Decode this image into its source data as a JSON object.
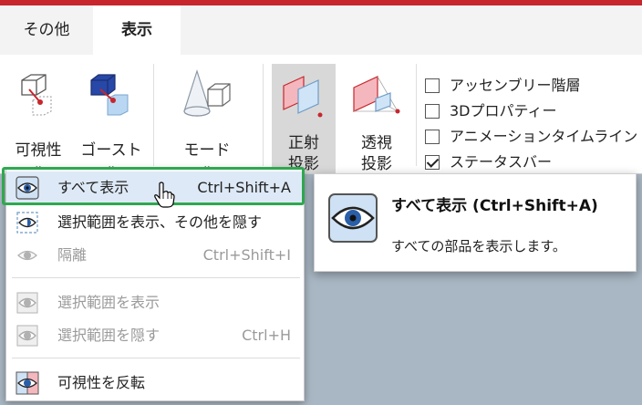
{
  "tabs": [
    {
      "label": "その他"
    },
    {
      "label": "表示"
    }
  ],
  "ribbon": {
    "visibility": {
      "label": "可視性"
    },
    "ghost": {
      "label": "ゴースト"
    },
    "mode": {
      "label": "モード"
    },
    "orthographic": {
      "line1": "正射",
      "line2": "投影"
    },
    "perspective": {
      "line1": "透視",
      "line2": "投影"
    },
    "checkboxes": [
      {
        "label": "アッセンブリー階層",
        "checked": false
      },
      {
        "label": "3Dプロパティー",
        "checked": false
      },
      {
        "label": "アニメーションタイムライン",
        "checked": false
      },
      {
        "label": "ステータスバー",
        "checked": true
      }
    ]
  },
  "menu": {
    "items": [
      {
        "label": "すべて表示",
        "shortcut": "Ctrl+Shift+A",
        "enabled": true,
        "highlighted": true,
        "icon": "eye-icon"
      },
      {
        "label": "選択範囲を表示、その他を隠す",
        "shortcut": "",
        "enabled": true,
        "icon": "eye-half-icon"
      },
      {
        "label": "隔離",
        "shortcut": "Ctrl+Shift+I",
        "enabled": false,
        "icon": "eye-icon"
      },
      {
        "label": "選択範囲を表示",
        "shortcut": "",
        "enabled": false,
        "icon": "eye-selection-icon"
      },
      {
        "label": "選択範囲を隠す",
        "shortcut": "Ctrl+H",
        "enabled": false,
        "icon": "eye-hidden-icon"
      },
      {
        "label": "可視性を反転",
        "shortcut": "",
        "enabled": true,
        "icon": "eye-invert-icon"
      }
    ]
  },
  "tooltip": {
    "title": "すべて表示 (Ctrl+Shift+A)",
    "description": "すべての部品を表示します。"
  },
  "colors": {
    "accent": "#c7262c",
    "focus": "#2fa84f",
    "highlight": "#dde9f6"
  }
}
